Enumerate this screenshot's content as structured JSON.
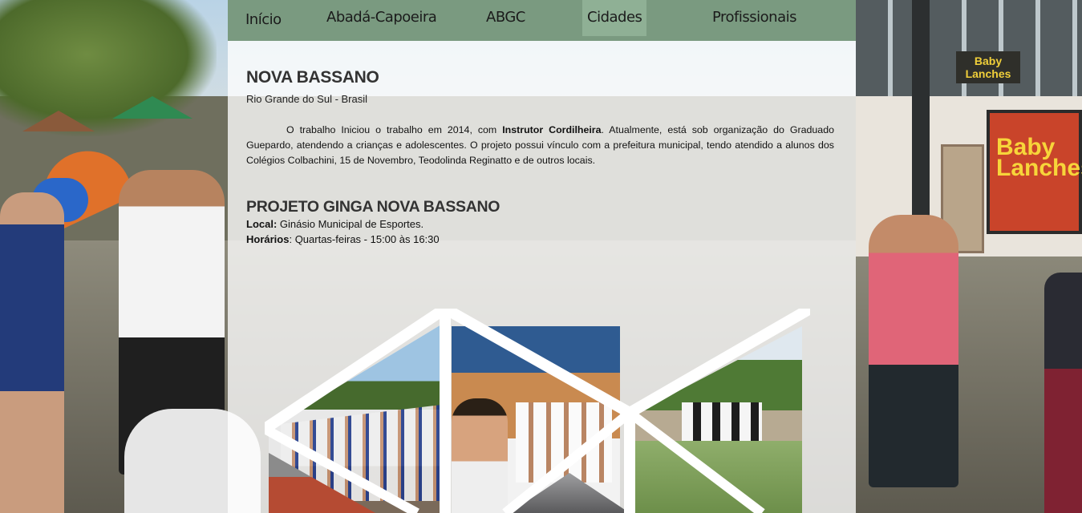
{
  "nav": {
    "items": [
      {
        "label": "Início",
        "active": false
      },
      {
        "label": "Abadá-Capoeira",
        "active": false
      },
      {
        "label": "ABGC",
        "active": false
      },
      {
        "label": "Cidades",
        "active": true
      },
      {
        "label": "Profissionais",
        "active": false
      }
    ]
  },
  "city": {
    "title": "NOVA BASSANO",
    "subtitle": "Rio Grande do Sul - Brasil",
    "para_before_bold": "O trabalho Iniciou o trabalho em 2014, com ",
    "para_bold": "Instrutor Cordilheira",
    "para_after_bold": ". Atualmente, está sob organização do Graduado Guepardo, atendendo a crianças e adolescentes. O projeto possui vínculo com a prefeitura municipal, tendo atendido a alunos dos Colégios Colbachini, 15 de Novembro, Teodolinda Reginatto e de outros locais."
  },
  "project": {
    "title": "PROJETO GINGA NOVA BASSANO",
    "local_label": "Local:",
    "local_value": " Ginásio Municipal de Esportes.",
    "hours_label": "Horários",
    "hours_value": ": Quartas-feiras - 15:00 às 16:30"
  },
  "background": {
    "sign_text": "Baby Lanches",
    "small_sign_text": "Baby Lanches"
  },
  "colors": {
    "navbar": "#7a9a80",
    "nav_active": "#8fb095",
    "panel_overlay": "rgba(255,255,255,0.78)"
  }
}
